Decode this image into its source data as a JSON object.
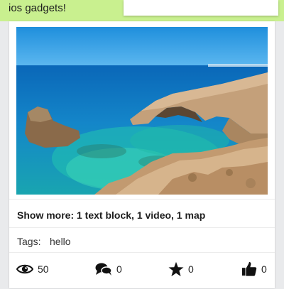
{
  "header": {
    "message_text": "ios gadgets!"
  },
  "post": {
    "image_alt": "coastal rock arch over turquoise sea",
    "show_more_text": "Show more: 1 text block, 1 video, 1 map",
    "tags_label": "Tags:",
    "tags": [
      "hello"
    ],
    "stats": {
      "views": "50",
      "comments": "0",
      "favorites": "0",
      "likes": "0"
    }
  },
  "colors": {
    "message_bubble": "#c9f08f",
    "card_background": "#ffffff",
    "page_background": "#e9eaec"
  },
  "icons": [
    "eye-icon",
    "comments-icon",
    "star-icon",
    "thumbs-up-icon"
  ]
}
